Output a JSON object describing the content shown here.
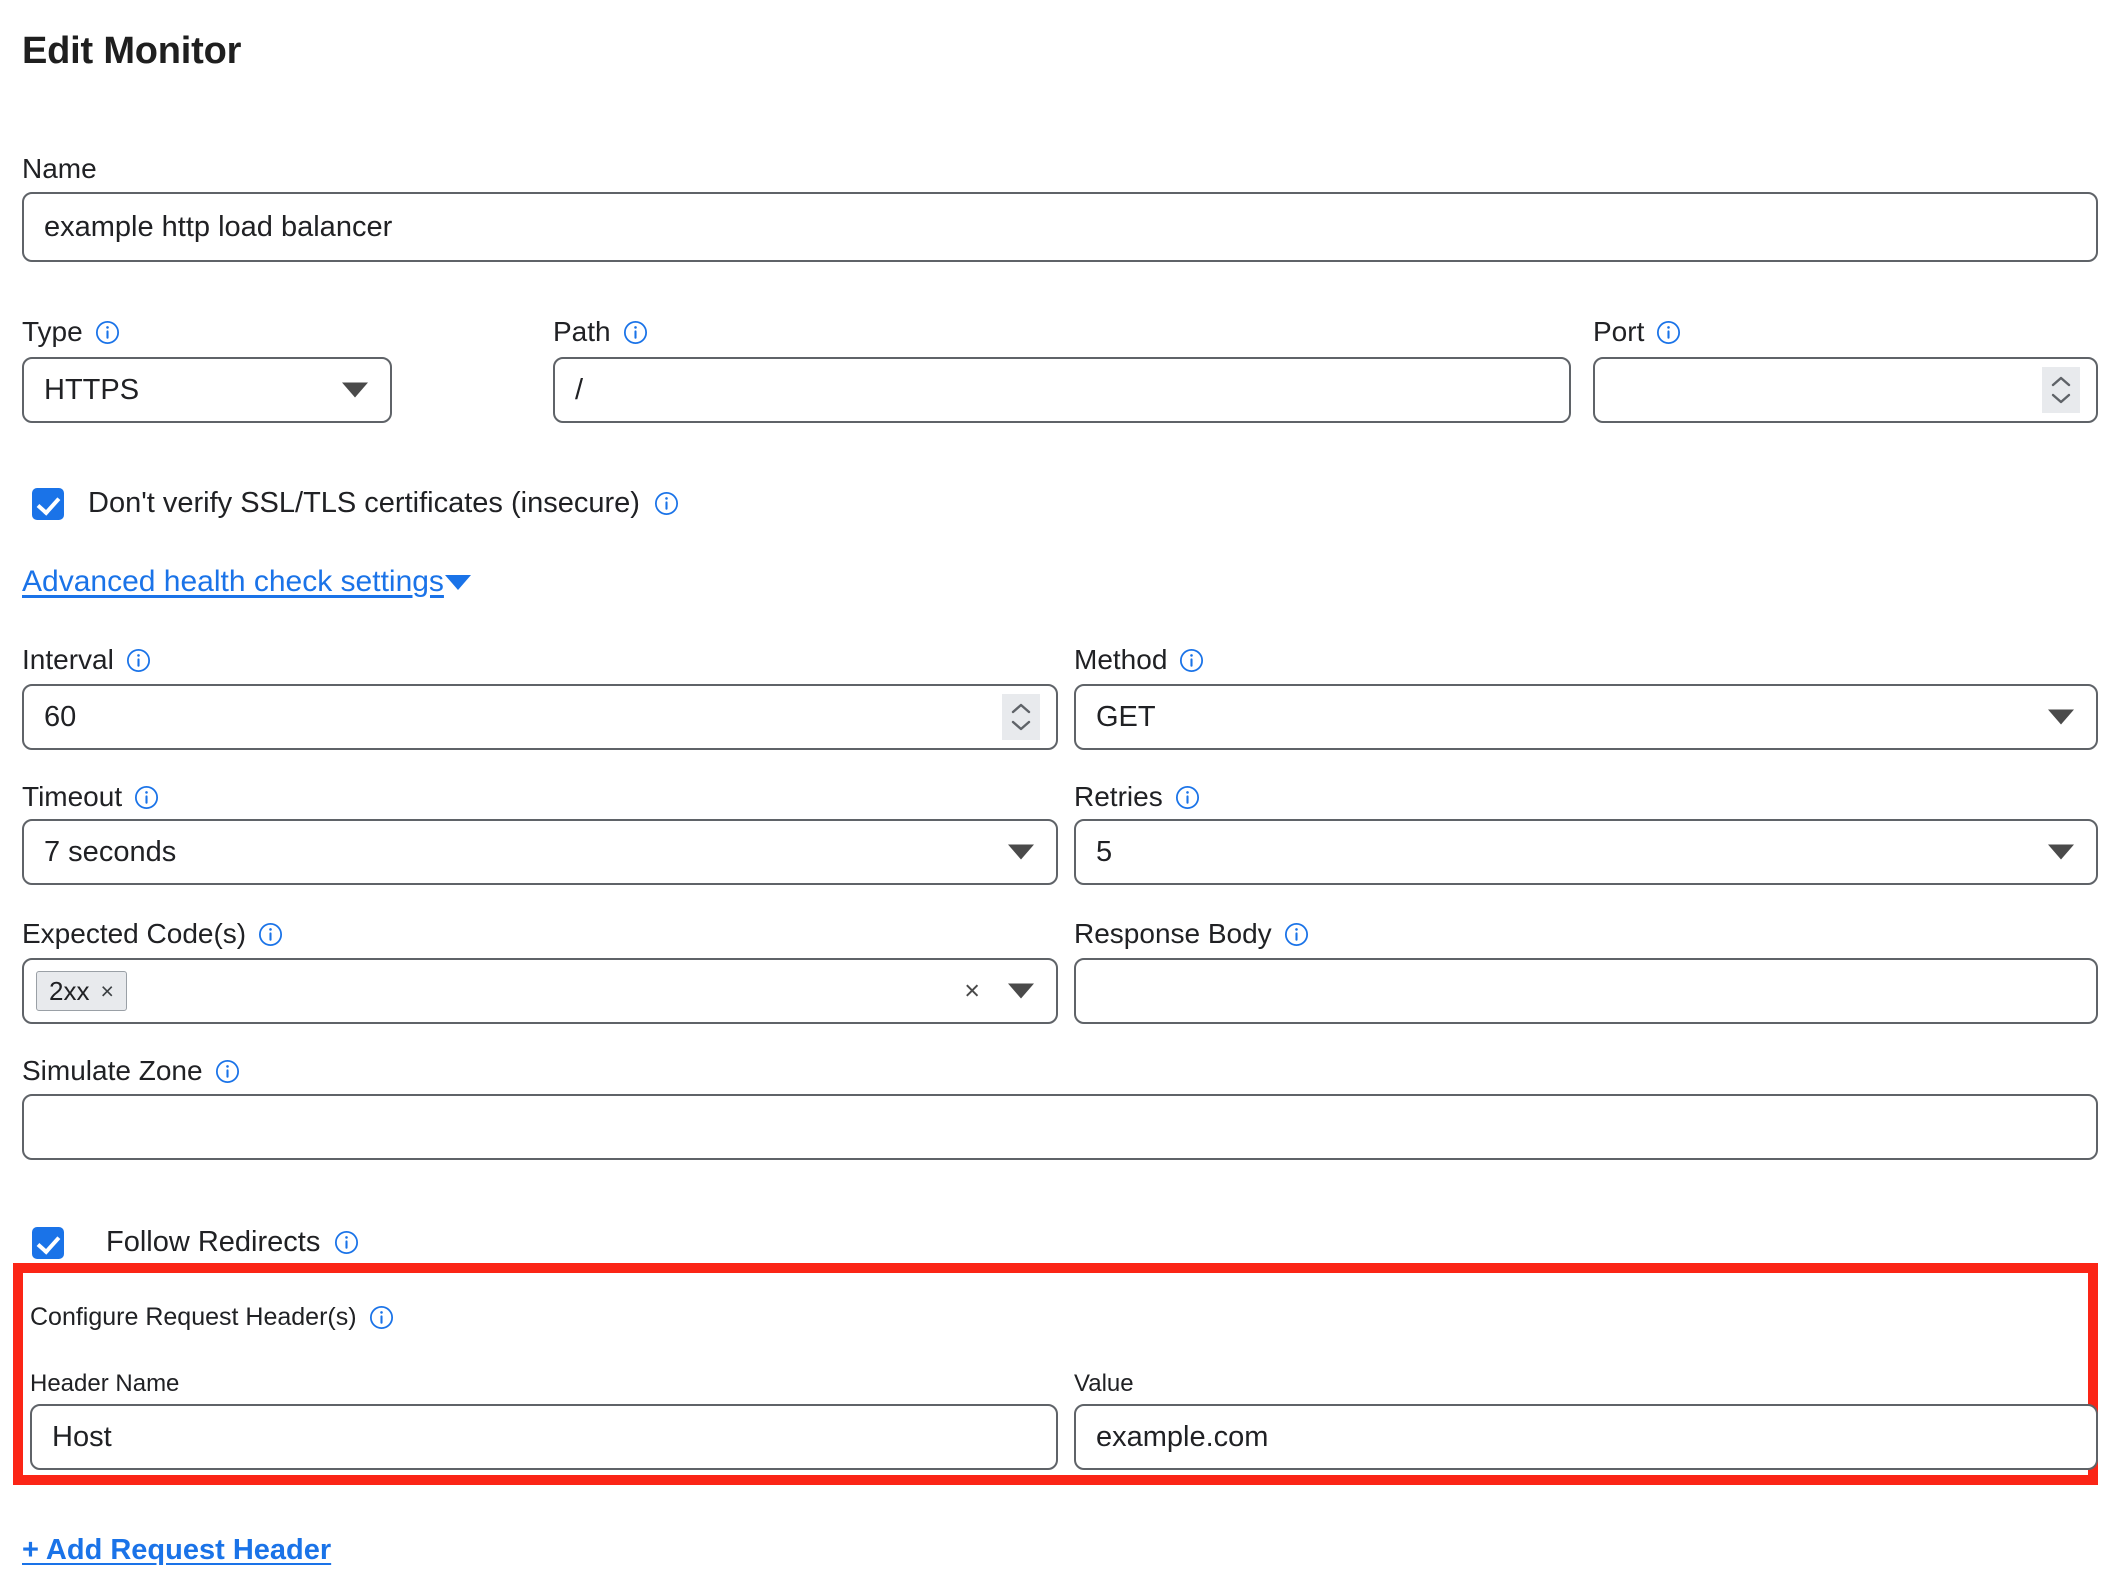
{
  "page": {
    "title": "Edit Monitor"
  },
  "icons": {
    "info": "info-circle-icon",
    "caret_down": "chevron-down-icon",
    "spinner": "number-stepper-icon",
    "clear": "clear-x-icon"
  },
  "fields": {
    "name": {
      "label": "Name",
      "value": "example http load balancer",
      "placeholder": ""
    },
    "type": {
      "label": "Type",
      "value": "HTTPS",
      "has_info": true
    },
    "path": {
      "label": "Path",
      "value": "/",
      "has_info": true
    },
    "port": {
      "label": "Port",
      "value": "",
      "placeholder": "",
      "has_info": true
    },
    "insecure": {
      "label": "Don't verify SSL/TLS certificates (insecure)",
      "checked": true,
      "has_info": true
    },
    "advanced_toggle": {
      "label": "Advanced health check settings",
      "expanded": true
    },
    "interval": {
      "label": "Interval",
      "value": "60",
      "has_info": true
    },
    "method": {
      "label": "Method",
      "value": "GET",
      "has_info": true
    },
    "timeout": {
      "label": "Timeout",
      "value": "7 seconds",
      "has_info": true
    },
    "retries": {
      "label": "Retries",
      "value": "5",
      "has_info": true
    },
    "expected_codes": {
      "label": "Expected Code(s)",
      "has_info": true,
      "chips": [
        {
          "text": "2xx",
          "remove": "×"
        }
      ],
      "clear_all": "×"
    },
    "response_body": {
      "label": "Response Body",
      "value": "",
      "has_info": true
    },
    "simulate_zone": {
      "label": "Simulate Zone",
      "value": "",
      "has_info": true
    },
    "follow_redirects": {
      "label": "Follow Redirects",
      "checked": true,
      "has_info": true
    }
  },
  "request_headers": {
    "section_label": "Configure Request Header(s)",
    "has_info": true,
    "highlighted": true,
    "highlight_color": "#fb2516",
    "columns": {
      "name": "Header Name",
      "value": "Value"
    },
    "rows": [
      {
        "name": "Host",
        "value": "example.com"
      }
    ],
    "add_link": "+ Add Request Header"
  },
  "colors": {
    "accent_blue": "#1a73e8",
    "highlight_red": "#fb2516",
    "border_gray": "#5f6368",
    "text": "#202124"
  }
}
